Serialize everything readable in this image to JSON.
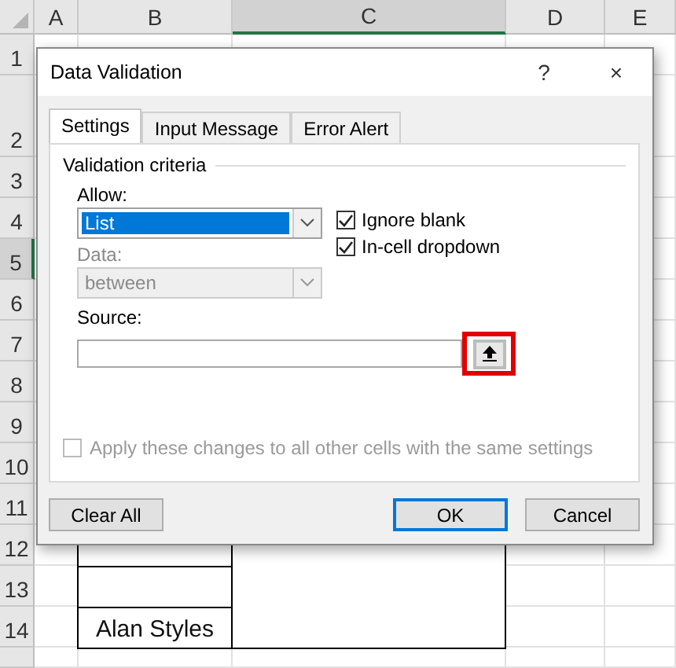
{
  "sheet": {
    "columns": [
      {
        "label": "A",
        "selected": false
      },
      {
        "label": "B",
        "selected": false
      },
      {
        "label": "C",
        "selected": true
      },
      {
        "label": "D",
        "selected": false
      },
      {
        "label": "E",
        "selected": false
      }
    ],
    "rows": [
      {
        "label": "1",
        "selected": false
      },
      {
        "label": "2",
        "selected": false
      },
      {
        "label": "3",
        "selected": false
      },
      {
        "label": "4",
        "selected": false
      },
      {
        "label": "5",
        "selected": true
      },
      {
        "label": "6",
        "selected": false
      },
      {
        "label": "7",
        "selected": false
      },
      {
        "label": "8",
        "selected": false
      },
      {
        "label": "9",
        "selected": false
      },
      {
        "label": "10",
        "selected": false
      },
      {
        "label": "11",
        "selected": false
      },
      {
        "label": "12",
        "selected": false
      },
      {
        "label": "13",
        "selected": false
      },
      {
        "label": "14",
        "selected": false
      }
    ],
    "names": [
      {
        "kind": "empty"
      },
      {
        "kind": "empty"
      },
      {
        "kind": "name",
        "text": "Alan Styles"
      }
    ]
  },
  "dialog": {
    "title": "Data Validation",
    "help": "?",
    "close": "×",
    "tabs": [
      {
        "label": "Settings",
        "selected": true
      },
      {
        "label": "Input Message",
        "selected": false
      },
      {
        "label": "Error Alert",
        "selected": false
      }
    ],
    "group_label": "Validation criteria",
    "allow": {
      "label": "Allow:",
      "value": "List",
      "disabled": false
    },
    "data": {
      "label": "Data:",
      "value": "between",
      "disabled": true
    },
    "checkboxes": [
      {
        "label": "Ignore blank",
        "checked": true
      },
      {
        "label": "In-cell dropdown",
        "checked": true
      }
    ],
    "source": {
      "label": "Source:",
      "highlighted": true
    },
    "apply": {
      "label": "Apply these changes to all other cells with the same settings",
      "checked": false,
      "disabled": true
    },
    "buttons": [
      {
        "label": "Clear All",
        "default": false,
        "kind": "left"
      },
      {
        "label": "OK",
        "default": true,
        "kind": "right"
      },
      {
        "label": "Cancel",
        "default": false,
        "kind": "right"
      }
    ]
  }
}
